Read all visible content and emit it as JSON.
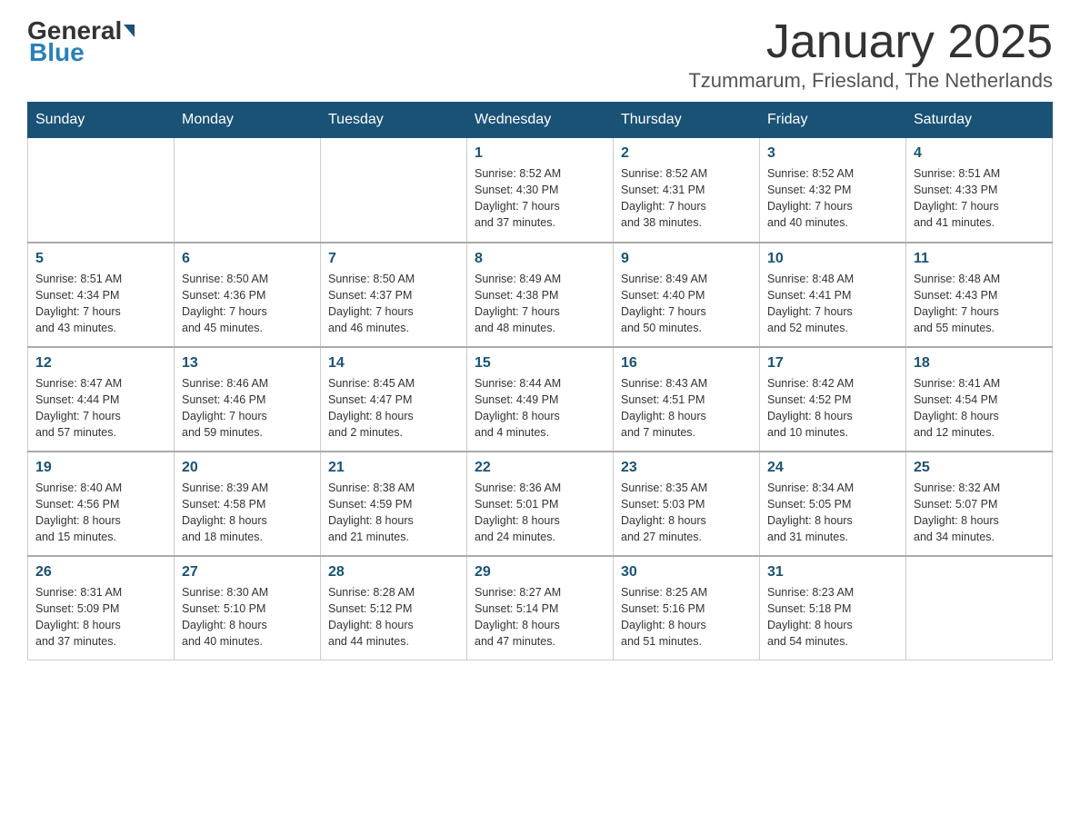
{
  "header": {
    "logo_general": "General",
    "logo_blue": "Blue",
    "month_title": "January 2025",
    "subtitle": "Tzummarum, Friesland, The Netherlands"
  },
  "days_of_week": [
    "Sunday",
    "Monday",
    "Tuesday",
    "Wednesday",
    "Thursday",
    "Friday",
    "Saturday"
  ],
  "weeks": [
    [
      {
        "day": "",
        "info": ""
      },
      {
        "day": "",
        "info": ""
      },
      {
        "day": "",
        "info": ""
      },
      {
        "day": "1",
        "info": "Sunrise: 8:52 AM\nSunset: 4:30 PM\nDaylight: 7 hours\nand 37 minutes."
      },
      {
        "day": "2",
        "info": "Sunrise: 8:52 AM\nSunset: 4:31 PM\nDaylight: 7 hours\nand 38 minutes."
      },
      {
        "day": "3",
        "info": "Sunrise: 8:52 AM\nSunset: 4:32 PM\nDaylight: 7 hours\nand 40 minutes."
      },
      {
        "day": "4",
        "info": "Sunrise: 8:51 AM\nSunset: 4:33 PM\nDaylight: 7 hours\nand 41 minutes."
      }
    ],
    [
      {
        "day": "5",
        "info": "Sunrise: 8:51 AM\nSunset: 4:34 PM\nDaylight: 7 hours\nand 43 minutes."
      },
      {
        "day": "6",
        "info": "Sunrise: 8:50 AM\nSunset: 4:36 PM\nDaylight: 7 hours\nand 45 minutes."
      },
      {
        "day": "7",
        "info": "Sunrise: 8:50 AM\nSunset: 4:37 PM\nDaylight: 7 hours\nand 46 minutes."
      },
      {
        "day": "8",
        "info": "Sunrise: 8:49 AM\nSunset: 4:38 PM\nDaylight: 7 hours\nand 48 minutes."
      },
      {
        "day": "9",
        "info": "Sunrise: 8:49 AM\nSunset: 4:40 PM\nDaylight: 7 hours\nand 50 minutes."
      },
      {
        "day": "10",
        "info": "Sunrise: 8:48 AM\nSunset: 4:41 PM\nDaylight: 7 hours\nand 52 minutes."
      },
      {
        "day": "11",
        "info": "Sunrise: 8:48 AM\nSunset: 4:43 PM\nDaylight: 7 hours\nand 55 minutes."
      }
    ],
    [
      {
        "day": "12",
        "info": "Sunrise: 8:47 AM\nSunset: 4:44 PM\nDaylight: 7 hours\nand 57 minutes."
      },
      {
        "day": "13",
        "info": "Sunrise: 8:46 AM\nSunset: 4:46 PM\nDaylight: 7 hours\nand 59 minutes."
      },
      {
        "day": "14",
        "info": "Sunrise: 8:45 AM\nSunset: 4:47 PM\nDaylight: 8 hours\nand 2 minutes."
      },
      {
        "day": "15",
        "info": "Sunrise: 8:44 AM\nSunset: 4:49 PM\nDaylight: 8 hours\nand 4 minutes."
      },
      {
        "day": "16",
        "info": "Sunrise: 8:43 AM\nSunset: 4:51 PM\nDaylight: 8 hours\nand 7 minutes."
      },
      {
        "day": "17",
        "info": "Sunrise: 8:42 AM\nSunset: 4:52 PM\nDaylight: 8 hours\nand 10 minutes."
      },
      {
        "day": "18",
        "info": "Sunrise: 8:41 AM\nSunset: 4:54 PM\nDaylight: 8 hours\nand 12 minutes."
      }
    ],
    [
      {
        "day": "19",
        "info": "Sunrise: 8:40 AM\nSunset: 4:56 PM\nDaylight: 8 hours\nand 15 minutes."
      },
      {
        "day": "20",
        "info": "Sunrise: 8:39 AM\nSunset: 4:58 PM\nDaylight: 8 hours\nand 18 minutes."
      },
      {
        "day": "21",
        "info": "Sunrise: 8:38 AM\nSunset: 4:59 PM\nDaylight: 8 hours\nand 21 minutes."
      },
      {
        "day": "22",
        "info": "Sunrise: 8:36 AM\nSunset: 5:01 PM\nDaylight: 8 hours\nand 24 minutes."
      },
      {
        "day": "23",
        "info": "Sunrise: 8:35 AM\nSunset: 5:03 PM\nDaylight: 8 hours\nand 27 minutes."
      },
      {
        "day": "24",
        "info": "Sunrise: 8:34 AM\nSunset: 5:05 PM\nDaylight: 8 hours\nand 31 minutes."
      },
      {
        "day": "25",
        "info": "Sunrise: 8:32 AM\nSunset: 5:07 PM\nDaylight: 8 hours\nand 34 minutes."
      }
    ],
    [
      {
        "day": "26",
        "info": "Sunrise: 8:31 AM\nSunset: 5:09 PM\nDaylight: 8 hours\nand 37 minutes."
      },
      {
        "day": "27",
        "info": "Sunrise: 8:30 AM\nSunset: 5:10 PM\nDaylight: 8 hours\nand 40 minutes."
      },
      {
        "day": "28",
        "info": "Sunrise: 8:28 AM\nSunset: 5:12 PM\nDaylight: 8 hours\nand 44 minutes."
      },
      {
        "day": "29",
        "info": "Sunrise: 8:27 AM\nSunset: 5:14 PM\nDaylight: 8 hours\nand 47 minutes."
      },
      {
        "day": "30",
        "info": "Sunrise: 8:25 AM\nSunset: 5:16 PM\nDaylight: 8 hours\nand 51 minutes."
      },
      {
        "day": "31",
        "info": "Sunrise: 8:23 AM\nSunset: 5:18 PM\nDaylight: 8 hours\nand 54 minutes."
      },
      {
        "day": "",
        "info": ""
      }
    ]
  ]
}
